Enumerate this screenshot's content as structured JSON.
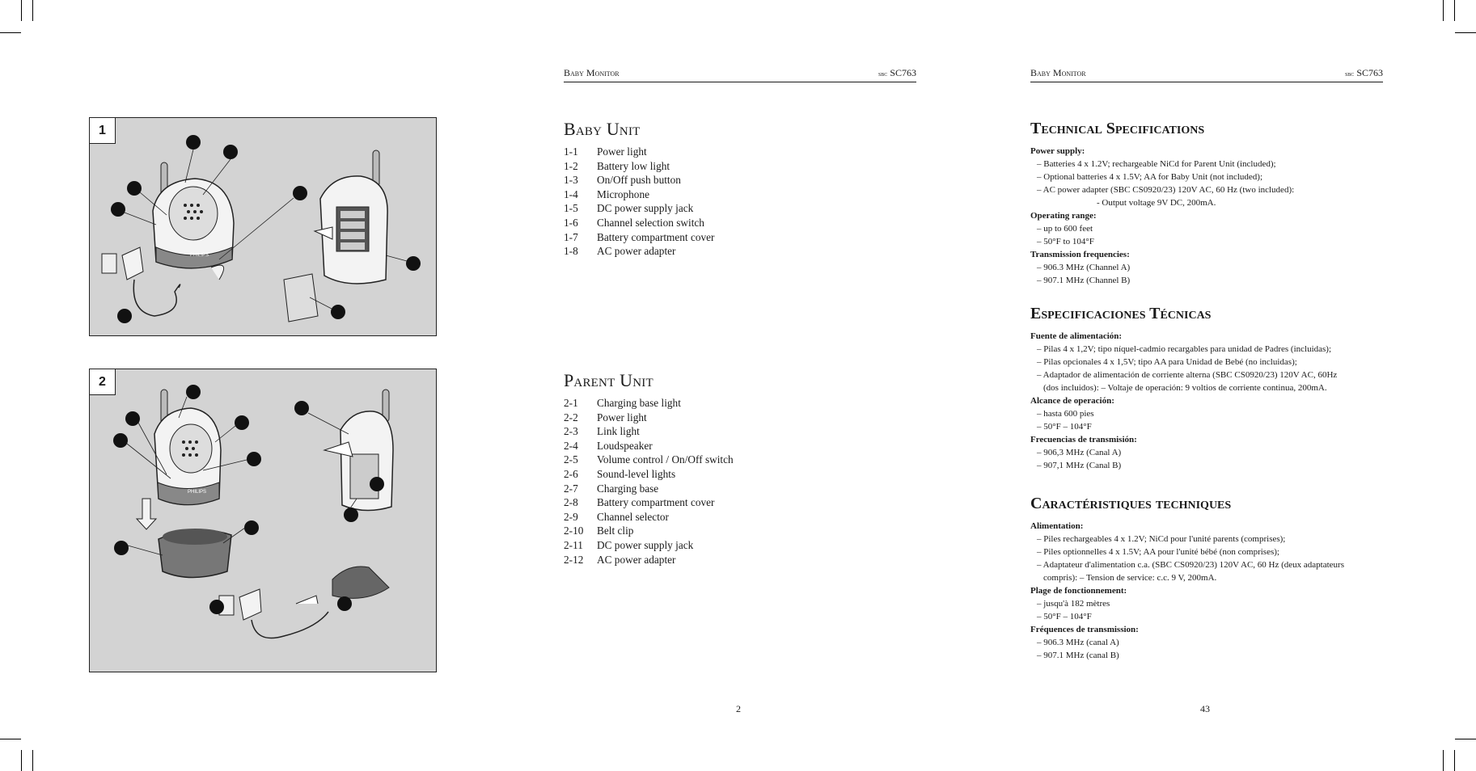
{
  "left_page": {
    "header": {
      "title": "Baby Monitor",
      "model_prefix": "sbc",
      "model": "SC763"
    },
    "baby_unit": {
      "title": "Baby Unit",
      "items": [
        {
          "num": "1-1",
          "label": "Power light"
        },
        {
          "num": "1-2",
          "label": "Battery low light"
        },
        {
          "num": "1-3",
          "label": "On/Off push button"
        },
        {
          "num": "1-4",
          "label": "Microphone"
        },
        {
          "num": "1-5",
          "label": "DC power supply jack"
        },
        {
          "num": "1-6",
          "label": "Channel selection switch"
        },
        {
          "num": "1-7",
          "label": "Battery compartment cover"
        },
        {
          "num": "1-8",
          "label": "AC power adapter"
        }
      ]
    },
    "parent_unit": {
      "title": "Parent Unit",
      "items": [
        {
          "num": "2-1",
          "label": "Charging base light"
        },
        {
          "num": "2-2",
          "label": "Power light"
        },
        {
          "num": "2-3",
          "label": "Link light"
        },
        {
          "num": "2-4",
          "label": "Loudspeaker"
        },
        {
          "num": "2-5",
          "label": "Volume control / On/Off switch"
        },
        {
          "num": "2-6",
          "label": "Sound-level lights"
        },
        {
          "num": "2-7",
          "label": "Charging base"
        },
        {
          "num": "2-8",
          "label": "Battery compartment cover"
        },
        {
          "num": "2-9",
          "label": "Channel selector"
        },
        {
          "num": "2-10",
          "label": "Belt clip"
        },
        {
          "num": "2-11",
          "label": "DC power supply jack"
        },
        {
          "num": "2-12",
          "label": "AC power adapter"
        }
      ]
    },
    "page_number": "2"
  },
  "figures": [
    {
      "label": "1",
      "brand": "PHILIPS",
      "background": "#d3d3d3"
    },
    {
      "label": "2",
      "brand": "PHILIPS",
      "background": "#d3d3d3"
    }
  ],
  "right_page": {
    "header": {
      "title": "Baby Monitor",
      "model_prefix": "sbc",
      "model": "SC763"
    },
    "english": {
      "title": "Technical Specifications",
      "groups": [
        {
          "heading": "Power supply:",
          "lines": [
            "– Batteries 4 x 1.2V; rechargeable NiCd for Parent Unit (included);",
            "– Optional batteries 4 x 1.5V; AA for Baby Unit (not included);",
            "– AC power adapter (SBC CS0920/23) 120V AC, 60 Hz (two included):",
            "- Output voltage 9V DC, 200mA."
          ]
        },
        {
          "heading": "Operating range:",
          "lines": [
            "– up to 600 feet",
            "– 50°F to 104°F"
          ]
        },
        {
          "heading": "Transmission frequencies:",
          "lines": [
            "– 906.3 MHz (Channel A)",
            "– 907.1 MHz (Channel B)"
          ]
        }
      ]
    },
    "spanish": {
      "title": "Especificaciones Técnicas",
      "groups": [
        {
          "heading": "Fuente de alimentación:",
          "lines": [
            "– Pilas 4 x 1,2V; tipo níquel-cadmio recargables para unidad de Padres (incluidas);",
            "– Pilas opcionales 4 x 1,5V; tipo AA para Unidad de Bebé (no incluidas);",
            "– Adaptador de alimentación de corriente alterna (SBC CS0920/23) 120V AC, 60Hz",
            "(dos incluidos): – Voltaje de operación: 9 voltios de corriente continua, 200mA."
          ]
        },
        {
          "heading": "Alcance de operación:",
          "lines": [
            "– hasta 600 pies",
            "– 50°F – 104°F"
          ]
        },
        {
          "heading": "Frecuencias de transmisión:",
          "lines": [
            "– 906,3 MHz (Canal A)",
            "– 907,1 MHz (Canal B)"
          ]
        }
      ]
    },
    "french": {
      "title": "Caractéristiques techniques",
      "groups": [
        {
          "heading": "Alimentation:",
          "lines": [
            "– Piles rechargeables 4 x 1.2V; NiCd pour l'unité parents (comprises);",
            "– Piles optionnelles 4 x 1.5V; AA pour l'unité bébé (non comprises);",
            "– Adaptateur d'alimentation c.a. (SBC CS0920/23) 120V AC, 60 Hz (deux adaptateurs",
            "compris):      – Tension de service: c.c. 9 V, 200mA."
          ]
        },
        {
          "heading": "Plage de fonctionnement:",
          "lines": [
            "– jusqu'à 182 mètres",
            "– 50°F – 104°F"
          ]
        },
        {
          "heading": "Fréquences de transmission:",
          "lines": [
            "– 906.3 MHz (canal A)",
            "– 907.1 MHz (canal B)"
          ]
        }
      ]
    },
    "page_number": "43"
  }
}
